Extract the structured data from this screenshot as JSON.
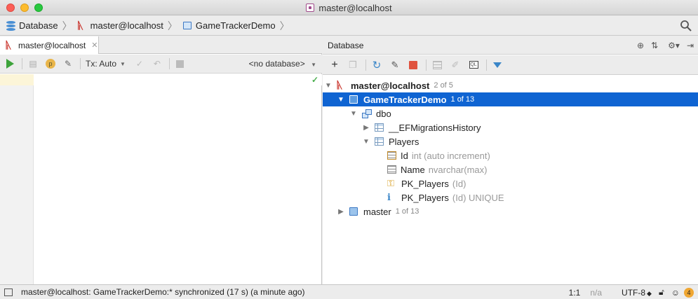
{
  "window": {
    "title": "master@localhost"
  },
  "breadcrumb": {
    "items": [
      {
        "label": "Database",
        "icon": "database-icon"
      },
      {
        "label": "master@localhost",
        "icon": "mssql-icon"
      },
      {
        "label": "GameTrackerDemo",
        "icon": "schema-icon"
      }
    ]
  },
  "editor": {
    "tab_label": "master@localhost",
    "tx_label": "Tx: Auto",
    "database_selector": "<no database>"
  },
  "db_panel": {
    "title": "Database",
    "tree": [
      {
        "label": "master@localhost",
        "meta": "2 of 5"
      },
      {
        "label": "GameTrackerDemo",
        "meta": "1 of 13"
      },
      {
        "label": "dbo"
      },
      {
        "label": "__EFMigrationsHistory"
      },
      {
        "label": "Players"
      },
      {
        "label": "Id",
        "type": "int (auto increment)"
      },
      {
        "label": "Name",
        "type": "nvarchar(max)"
      },
      {
        "label": "PK_Players",
        "type": "(Id)"
      },
      {
        "label": "PK_Players",
        "type": "(Id) UNIQUE"
      },
      {
        "label": "master",
        "meta": "1 of 13"
      }
    ]
  },
  "status": {
    "message": "master@localhost: GameTrackerDemo:* synchronized (17 s) (a minute ago)",
    "position": "1:1",
    "na": "n/a",
    "encoding": "UTF-8",
    "notifications": "4"
  },
  "colors": {
    "selection": "#0f64d2",
    "run": "#3da33b",
    "stop": "#e0533f",
    "filter": "#3a86c8"
  }
}
